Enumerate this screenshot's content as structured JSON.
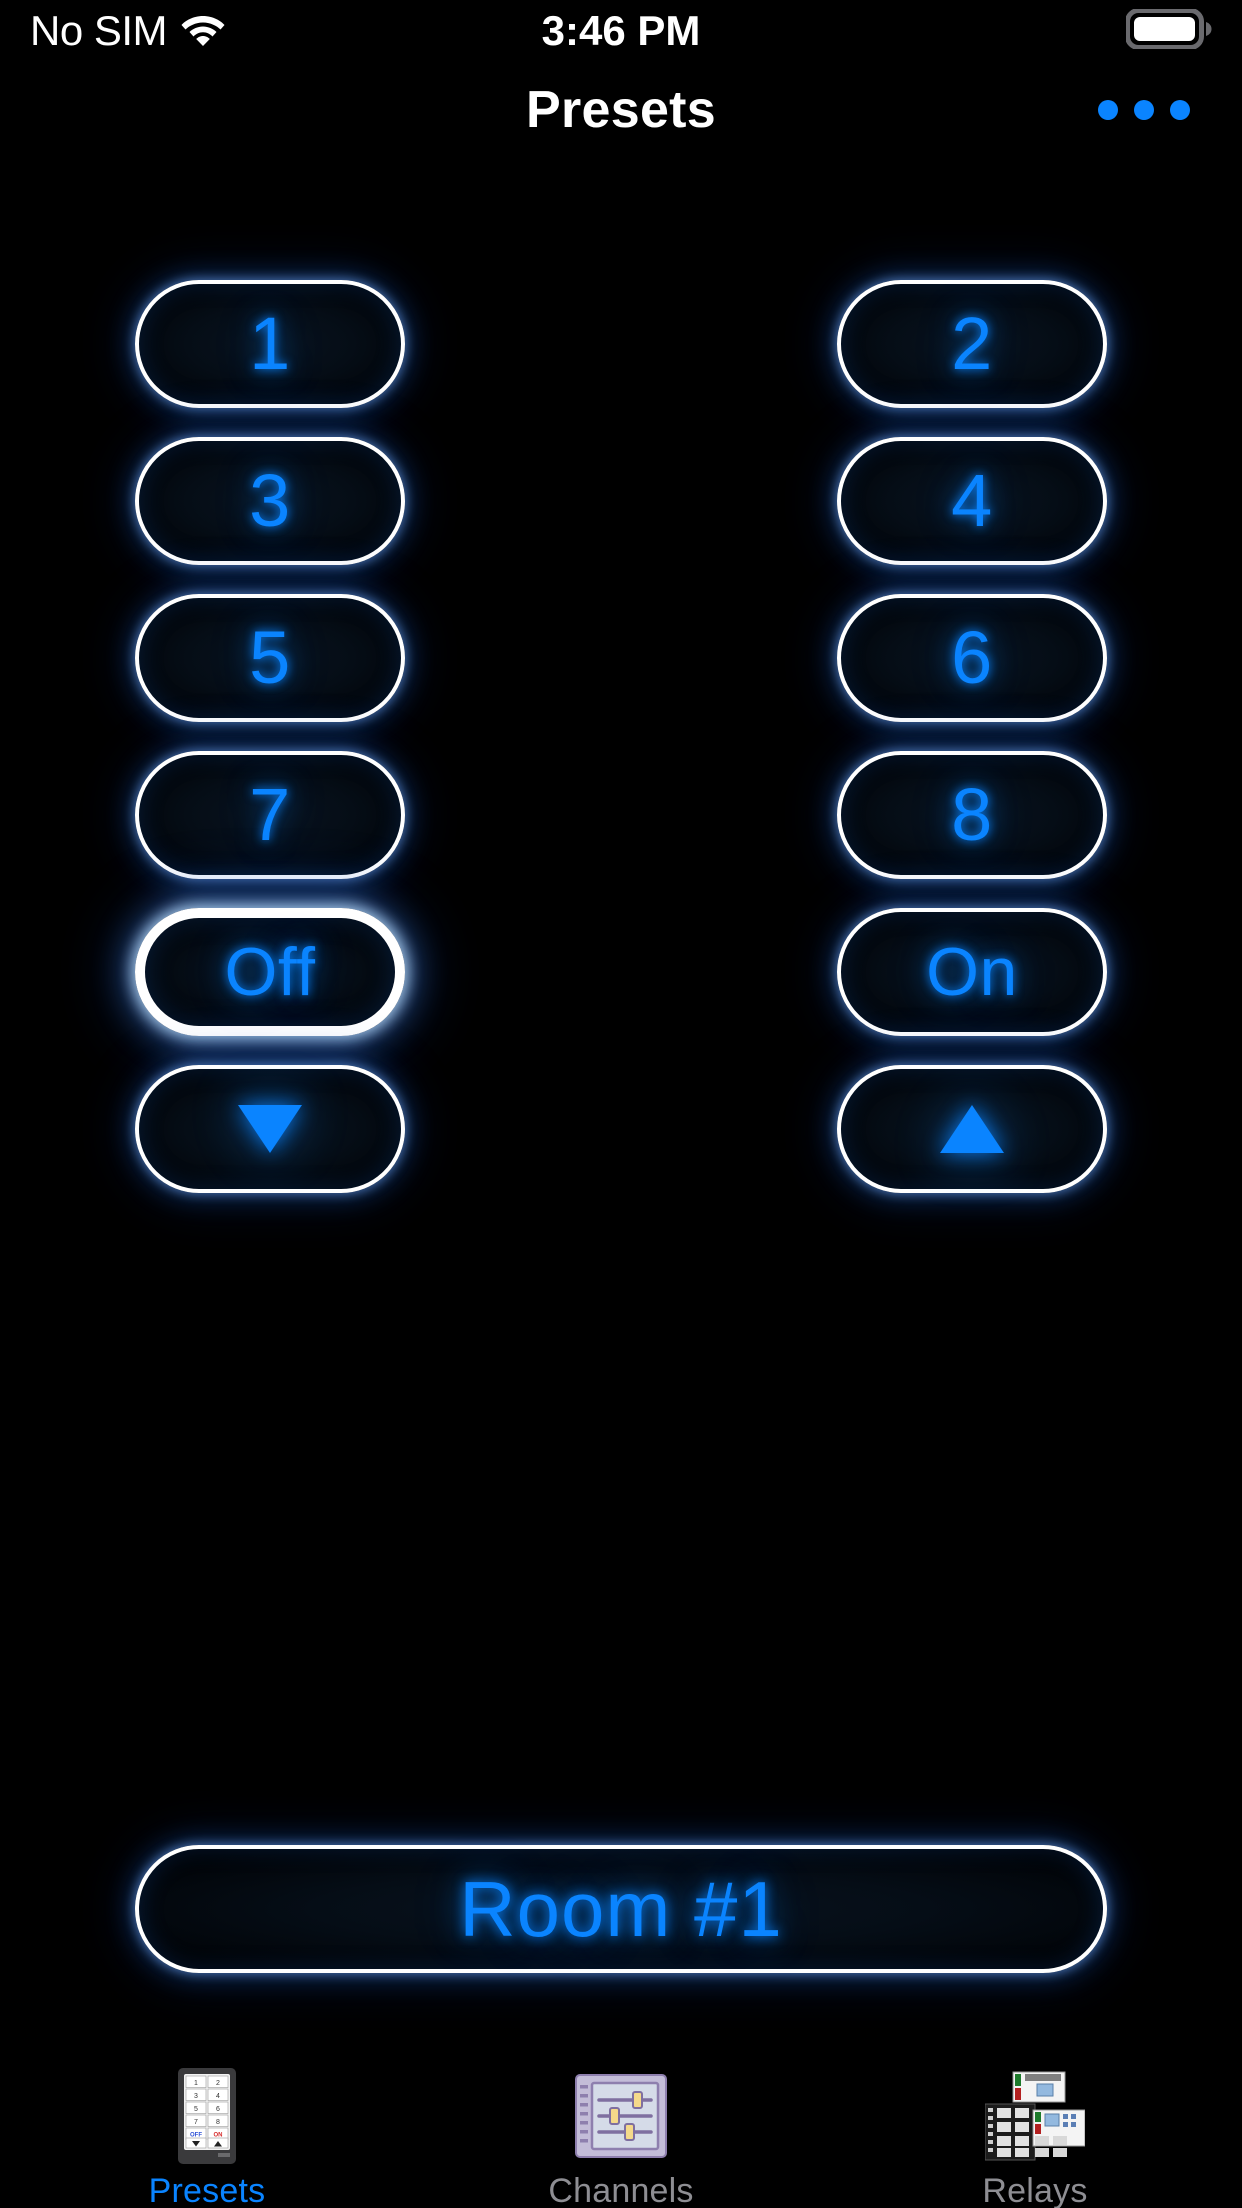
{
  "status_bar": {
    "carrier": "No SIM",
    "wifi_icon": "wifi-icon",
    "time": "3:46 PM",
    "battery_icon": "battery-full-icon"
  },
  "nav_bar": {
    "title": "Presets",
    "more_button": {
      "name": "more-options-button",
      "icon": "ellipsis-icon",
      "color": "#0a84ff"
    }
  },
  "keypad": {
    "buttons": [
      {
        "label": "1",
        "kind": "text",
        "selected": false
      },
      {
        "label": "2",
        "kind": "text",
        "selected": false
      },
      {
        "label": "3",
        "kind": "text",
        "selected": false
      },
      {
        "label": "4",
        "kind": "text",
        "selected": false
      },
      {
        "label": "5",
        "kind": "text",
        "selected": false
      },
      {
        "label": "6",
        "kind": "text",
        "selected": false
      },
      {
        "label": "7",
        "kind": "text",
        "selected": false
      },
      {
        "label": "8",
        "kind": "text",
        "selected": false
      },
      {
        "label": "Off",
        "kind": "word",
        "selected": true
      },
      {
        "label": "On",
        "kind": "word",
        "selected": false
      },
      {
        "label": "",
        "kind": "triangle-down",
        "icon": "triangle-down-icon",
        "selected": false
      },
      {
        "label": "",
        "kind": "triangle-up",
        "icon": "triangle-up-icon",
        "selected": false
      }
    ]
  },
  "room_selector": {
    "label": "Room #1",
    "name": "room-selector-button"
  },
  "tab_bar": {
    "tabs": [
      {
        "label": "Presets",
        "icon": "keypad-device-icon",
        "active": true
      },
      {
        "label": "Channels",
        "icon": "sliders-panel-icon",
        "active": false
      },
      {
        "label": "Relays",
        "icon": "relay-modules-icon",
        "active": false
      }
    ]
  },
  "colors": {
    "accent_blue": "#0a84ff",
    "background": "#000000",
    "border_white": "#ffffff",
    "tab_inactive": "#8e8e93"
  }
}
